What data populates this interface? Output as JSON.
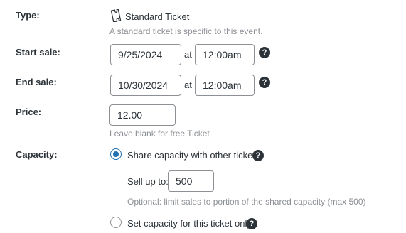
{
  "type_row": {
    "label": "Type:",
    "icon": "ticket-icon",
    "value": "Standard Ticket",
    "help": "A standard ticket is specific to this event."
  },
  "start_sale": {
    "label": "Start sale:",
    "date": "9/25/2024",
    "at": "at",
    "time": "12:00am"
  },
  "end_sale": {
    "label": "End sale:",
    "date": "10/30/2024",
    "at": "at",
    "time": "12:00am"
  },
  "price": {
    "label": "Price:",
    "value": "12.00",
    "help": "Leave blank for free Ticket"
  },
  "capacity": {
    "label": "Capacity:",
    "option_shared": "Share capacity with other tickets",
    "sell_up_to_label": "Sell up to:",
    "sell_up_to_value": "500",
    "sell_help": "Optional: limit sales to portion of the shared capacity (max 500)",
    "option_single": "Set capacity for this ticket only",
    "selected": "shared"
  },
  "colors": {
    "accent": "#2271b1",
    "help_icon": "#2c3338",
    "muted_text": "#8c8f94"
  },
  "help_icon_glyph": "?"
}
